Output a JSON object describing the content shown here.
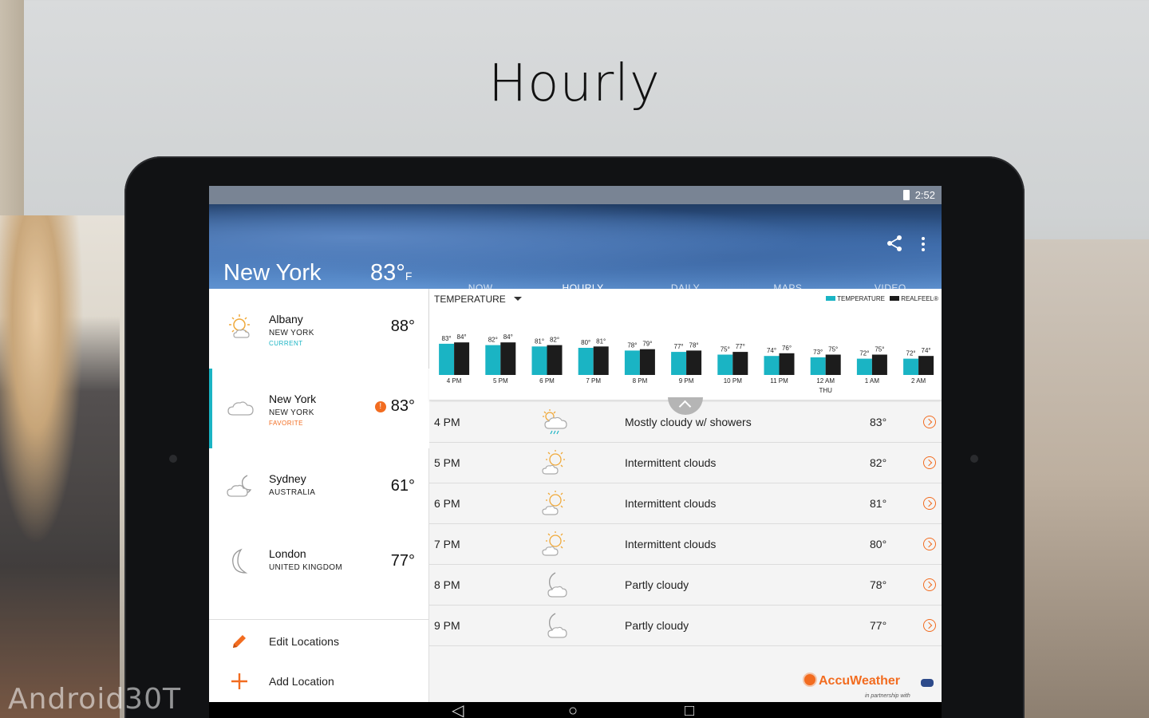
{
  "hero": {
    "title": "Hourly"
  },
  "watermark": "Android30T",
  "status": {
    "time": "2:52"
  },
  "header": {
    "city": "New York",
    "temp": "83°",
    "temp_unit": "F",
    "tabs": [
      {
        "label": "NOW",
        "active": false
      },
      {
        "label": "HOURLY",
        "active": true
      },
      {
        "label": "DAILY",
        "active": false
      },
      {
        "label": "MAPS",
        "active": false
      },
      {
        "label": "VIDEO",
        "active": false
      }
    ],
    "icons": [
      "share-icon",
      "more-vert-icon"
    ]
  },
  "locations": [
    {
      "name": "Albany",
      "region": "NEW YORK",
      "tag": "CURRENT",
      "temp": "88°",
      "icon": "sun-cloud-icon",
      "active": false,
      "alert": false
    },
    {
      "name": "New York",
      "region": "NEW YORK",
      "tag": "FAVORITE",
      "temp": "83°",
      "icon": "cloud-icon",
      "active": true,
      "alert": true,
      "alert_label": "!"
    },
    {
      "name": "Sydney",
      "region": "AUSTRALIA",
      "tag": "",
      "temp": "61°",
      "icon": "moon-cloud-icon",
      "active": false,
      "alert": false
    },
    {
      "name": "London",
      "region": "UNITED KINGDOM",
      "tag": "",
      "temp": "77°",
      "icon": "moon-icon",
      "active": false,
      "alert": false
    }
  ],
  "actions": {
    "edit": "Edit Locations",
    "add": "Add Location"
  },
  "chart_controls": {
    "selector": "TEMPERATURE",
    "legend_temperature": "TEMPERATURE",
    "legend_realfeel": "REALFEEL®",
    "colors": {
      "temperature": "#1ab4c4",
      "realfeel": "#1c1c1c"
    }
  },
  "chart_data": {
    "type": "bar",
    "categories": [
      "4 PM",
      "5 PM",
      "6 PM",
      "7 PM",
      "8 PM",
      "9 PM",
      "10 PM",
      "11 PM",
      "12 AM",
      "1 AM",
      "2 AM"
    ],
    "sub_labels": [
      "",
      "",
      "",
      "",
      "",
      "",
      "",
      "",
      "THU",
      "",
      ""
    ],
    "series": [
      {
        "name": "TEMPERATURE",
        "values": [
          83,
          82,
          81,
          80,
          78,
          77,
          75,
          74,
          73,
          72,
          72
        ]
      },
      {
        "name": "REALFEEL®",
        "values": [
          84,
          84,
          82,
          81,
          79,
          78,
          77,
          76,
          75,
          75,
          74
        ]
      }
    ]
  },
  "hourly": [
    {
      "time": "4 PM",
      "phrase": "Mostly cloudy w/ showers",
      "temp": "83°",
      "icon": "cloud-rain-sun-icon"
    },
    {
      "time": "5 PM",
      "phrase": "Intermittent clouds",
      "temp": "82°",
      "icon": "sun-cloud-icon"
    },
    {
      "time": "6 PM",
      "phrase": "Intermittent clouds",
      "temp": "81°",
      "icon": "sun-cloud-icon"
    },
    {
      "time": "7 PM",
      "phrase": "Intermittent clouds",
      "temp": "80°",
      "icon": "sun-cloud-icon"
    },
    {
      "time": "8 PM",
      "phrase": "Partly cloudy",
      "temp": "78°",
      "icon": "moon-cloud-icon"
    },
    {
      "time": "9 PM",
      "phrase": "Partly cloudy",
      "temp": "77°",
      "icon": "moon-cloud-icon"
    }
  ],
  "brand": {
    "name": "AccuWeather",
    "sub": "in partnership with"
  }
}
